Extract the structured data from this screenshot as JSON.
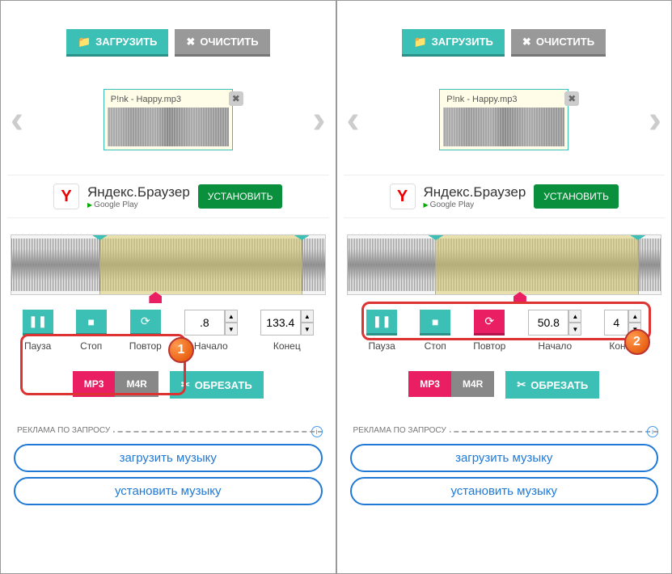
{
  "topbar": {
    "load": "ЗАГРУЗИТЬ",
    "clear": "ОЧИСТИТЬ"
  },
  "file": {
    "name": "P!nk - Happy.mp3"
  },
  "ad": {
    "title": "Яндекс.Браузер",
    "store": "Google Play",
    "install": "УСТАНОВИТЬ"
  },
  "controls": {
    "pause": "Пауза",
    "stop": "Стоп",
    "repeat": "Повтор",
    "start_label": "Начало",
    "end_label": "Конец",
    "start_val_a": ".8",
    "start_val_b": "50.8",
    "end_val": "133.4",
    "end_val_b": "4"
  },
  "format": {
    "mp3": "MP3",
    "m4r": "M4R",
    "cut": "ОБРЕЗАТЬ"
  },
  "ads": {
    "label": "РЕКЛАМА ПО ЗАПРОСУ",
    "link1": "загрузить музыку",
    "link2": "установить музыку"
  },
  "badges": {
    "one": "1",
    "two": "2"
  }
}
